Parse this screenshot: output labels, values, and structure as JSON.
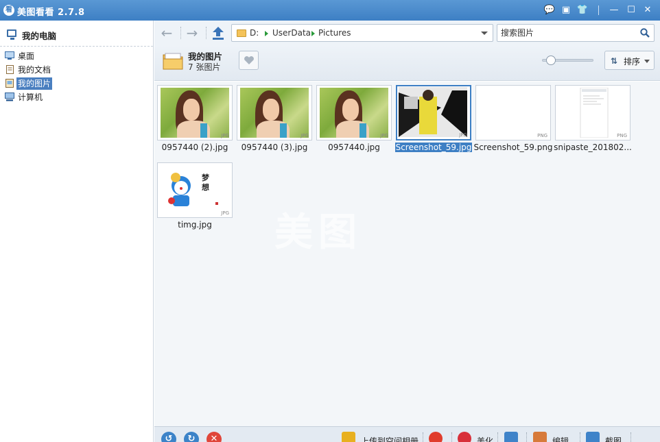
{
  "app": {
    "title": "美图看看 2.7.8",
    "logo_char": "看"
  },
  "titlebar_buttons": [
    {
      "name": "feedback-icon",
      "glyph": "💬"
    },
    {
      "name": "menu-icon",
      "glyph": "▣"
    },
    {
      "name": "skin-icon",
      "glyph": "👕"
    },
    {
      "name": "minimize-icon",
      "glyph": "—"
    },
    {
      "name": "maximize-icon",
      "glyph": "☐"
    },
    {
      "name": "close-icon",
      "glyph": "✕"
    }
  ],
  "sidebar": {
    "title": "我的电脑",
    "items": [
      {
        "label": "桌面",
        "icon": "desktop-icon"
      },
      {
        "label": "我的文档",
        "icon": "documents-icon"
      },
      {
        "label": "我的图片",
        "icon": "pictures-icon",
        "selected": true
      },
      {
        "label": "计算机",
        "icon": "computer-icon"
      }
    ]
  },
  "toolbar": {
    "back_glyph": "←",
    "forward_glyph": "→",
    "breadcrumb": [
      "D:",
      "UserData",
      "Pictures"
    ],
    "search_placeholder": "搜索图片"
  },
  "folder": {
    "name": "我的图片",
    "count_text": "7 张图片",
    "sort_label": "排序",
    "sort_glyph": "⇅",
    "zoom_level": 0.1
  },
  "watermark": "美图",
  "images": [
    {
      "name": "0957440 (2).jpg",
      "ext": "JPG",
      "kind": "photo"
    },
    {
      "name": "0957440 (3).jpg",
      "ext": "JPG",
      "kind": "photo"
    },
    {
      "name": "0957440.jpg",
      "ext": "JPG",
      "kind": "photo"
    },
    {
      "name": "Screenshot_59.jpg",
      "ext": "JPG",
      "kind": "screenshot",
      "selected": true
    },
    {
      "name": "Screenshot_59.png",
      "ext": "PNG",
      "kind": "blank"
    },
    {
      "name": "snipaste_201802...",
      "ext": "PNG",
      "kind": "document"
    },
    {
      "name": "timg.jpg",
      "ext": "JPG",
      "kind": "cartoon",
      "caption_chars": "梦 想"
    }
  ],
  "bottombar": {
    "rotate_left_glyph": "↺",
    "rotate_right_glyph": "↻",
    "delete_glyph": "✕",
    "items": [
      {
        "label": "上传到空间相册",
        "icon": "qzone-upload-icon",
        "color": "#e8b020"
      },
      {
        "label": "",
        "icon": "weibo-icon",
        "color": "#e03c2c"
      },
      {
        "label": "美化",
        "icon": "beautify-icon",
        "color": "#d8303a"
      },
      {
        "label": "",
        "icon": "slideshow-icon",
        "color": "#3f83c9"
      },
      {
        "label": "编辑",
        "icon": "edit-icon",
        "color": "#d77a3a"
      },
      {
        "label": "截图",
        "icon": "screenshot-icon",
        "color": "#3f83c9"
      }
    ]
  },
  "colors": {
    "accent": "#3d7fc4",
    "title_bar": "#4a8ccf",
    "selection": "#4a7fc0"
  }
}
